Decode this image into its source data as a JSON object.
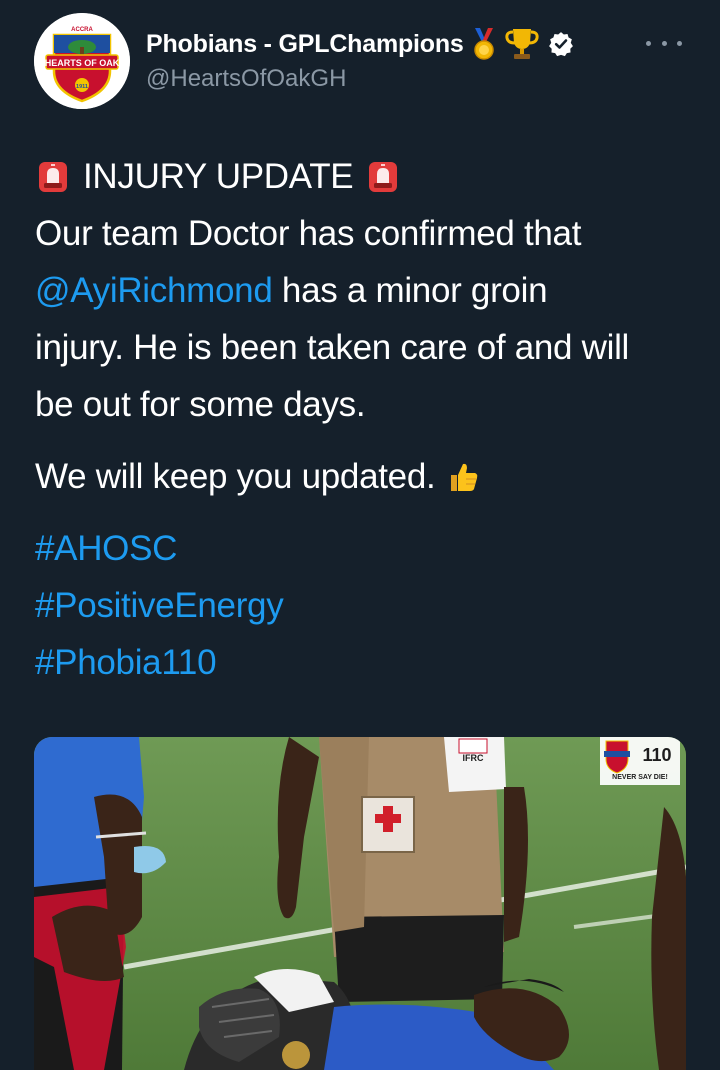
{
  "tweet": {
    "display_name": "Phobians - GPLChampions",
    "handle": "@HeartsOfOakGH",
    "avatar_alt_lines": [
      "ACCRA",
      "HEARTS OF OAK",
      "1911"
    ],
    "badges": [
      "medal-icon",
      "trophy-icon",
      "verified-icon"
    ],
    "more_icon": "more-icon",
    "headline_text": "INJURY UPDATE",
    "headline_emoji": "police-light-icon",
    "body_line1": "Our team Doctor  has confirmed that",
    "mention": "@AyiRichmond",
    "body_line2_rest": " has a minor groin",
    "body_line3": "injury. He is been taken care of and will",
    "body_line4": "be out for some days.",
    "update_text": "We will keep you updated.",
    "update_emoji": "thumbs-up-icon",
    "hashtags": [
      "#AHOSC",
      "#PositiveEnergy",
      "#Phobia110"
    ]
  },
  "media": {
    "vest_label": "IFRC",
    "watermark_number": "110",
    "watermark_tagline": "NEVER SAY DIE!"
  },
  "colors": {
    "background": "#15202b",
    "link": "#1d9bf0",
    "secondary_text": "#8b98a5",
    "verified": "#ffffff"
  }
}
